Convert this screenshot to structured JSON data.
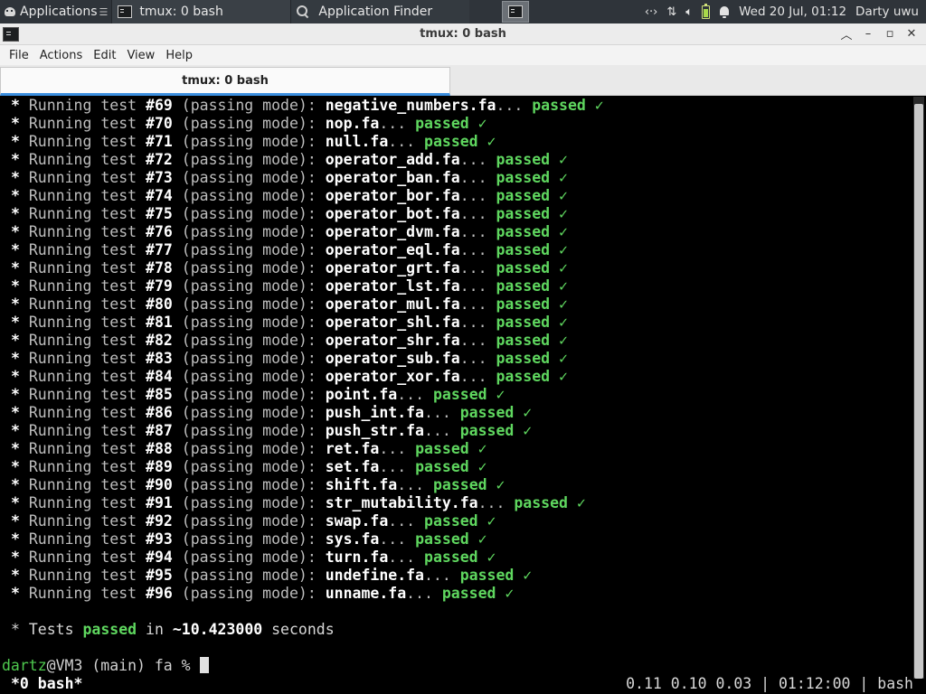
{
  "panel": {
    "applications_label": "Applications",
    "taskbar": [
      {
        "label": "tmux: 0 bash",
        "icon": "terminal-icon"
      },
      {
        "label": "Application Finder",
        "icon": "search-icon"
      }
    ],
    "tray": {
      "network_icon": "network-arrows-icon",
      "transfer_icon": "up-down-arrows-icon",
      "volume_icon": "speaker-icon",
      "battery_icon": "battery-icon",
      "notification_icon": "bell-icon",
      "clock": "Wed 20 Jul, 01:12",
      "user": "Darty uwu"
    }
  },
  "window": {
    "title": "tmux: 0 bash",
    "menu": [
      "File",
      "Actions",
      "Edit",
      "View",
      "Help"
    ],
    "tab_label": "tmux: 0 bash"
  },
  "terminal": {
    "tests": [
      {
        "num": "#69",
        "file": "negative_numbers.fa"
      },
      {
        "num": "#70",
        "file": "nop.fa"
      },
      {
        "num": "#71",
        "file": "null.fa"
      },
      {
        "num": "#72",
        "file": "operator_add.fa"
      },
      {
        "num": "#73",
        "file": "operator_ban.fa"
      },
      {
        "num": "#74",
        "file": "operator_bor.fa"
      },
      {
        "num": "#75",
        "file": "operator_bot.fa"
      },
      {
        "num": "#76",
        "file": "operator_dvm.fa"
      },
      {
        "num": "#77",
        "file": "operator_eql.fa"
      },
      {
        "num": "#78",
        "file": "operator_grt.fa"
      },
      {
        "num": "#79",
        "file": "operator_lst.fa"
      },
      {
        "num": "#80",
        "file": "operator_mul.fa"
      },
      {
        "num": "#81",
        "file": "operator_shl.fa"
      },
      {
        "num": "#82",
        "file": "operator_shr.fa"
      },
      {
        "num": "#83",
        "file": "operator_sub.fa"
      },
      {
        "num": "#84",
        "file": "operator_xor.fa"
      },
      {
        "num": "#85",
        "file": "point.fa"
      },
      {
        "num": "#86",
        "file": "push_int.fa"
      },
      {
        "num": "#87",
        "file": "push_str.fa"
      },
      {
        "num": "#88",
        "file": "ret.fa"
      },
      {
        "num": "#89",
        "file": "set.fa"
      },
      {
        "num": "#90",
        "file": "shift.fa"
      },
      {
        "num": "#91",
        "file": "str_mutability.fa"
      },
      {
        "num": "#92",
        "file": "swap.fa"
      },
      {
        "num": "#93",
        "file": "sys.fa"
      },
      {
        "num": "#94",
        "file": "turn.fa"
      },
      {
        "num": "#95",
        "file": "undefine.fa"
      },
      {
        "num": "#96",
        "file": "unname.fa"
      }
    ],
    "line_prefix": "* ",
    "running_text": "Running test ",
    "mode_text": " (passing mode): ",
    "ellipsis": "... ",
    "passed_text": "passed",
    "check": " ✓",
    "summary": {
      "prefix": "* Tests ",
      "passed": "passed",
      "middle": " in ",
      "time": "~10.423000",
      "suffix": " seconds"
    },
    "prompt": {
      "user": "dartz",
      "rest": "@VM3 (main) fa % "
    },
    "status_left": "*0 bash*",
    "status_right": "0.11 0.10 0.03 | 01:12:00 | bash"
  },
  "colors": {
    "passed_green": "#5fd75f",
    "prompt_green": "#4ec94e",
    "tab_accent": "#3b8ede",
    "panel_bg": "#2f343a"
  }
}
